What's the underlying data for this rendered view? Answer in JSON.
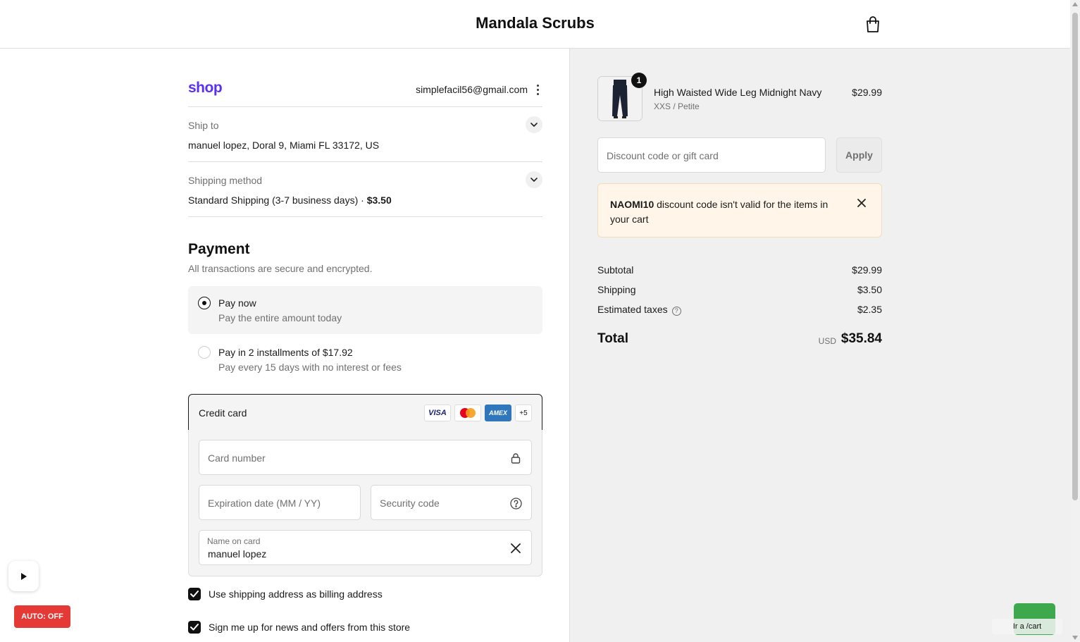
{
  "header": {
    "store_name": "Mandala Scrubs"
  },
  "account": {
    "logo": "shop",
    "email": "simplefacil56@gmail.com"
  },
  "ship_to": {
    "label": "Ship to",
    "value": "manuel lopez, Doral 9, Miami FL 33172, US"
  },
  "shipping_method": {
    "label": "Shipping method",
    "value": "Standard Shipping (3-7 business days)",
    "separator": "·",
    "price": "$3.50"
  },
  "payment": {
    "title": "Payment",
    "subtitle": "All transactions are secure and encrypted.",
    "options": [
      {
        "title": "Pay now",
        "subtitle": "Pay the entire amount today",
        "selected": true
      },
      {
        "title": "Pay in 2 installments of $17.92",
        "subtitle": "Pay every 15 days with no interest or fees",
        "selected": false
      }
    ],
    "credit_card": {
      "label": "Credit card",
      "badges": [
        "VISA",
        "AMEX",
        "+5"
      ],
      "card_number_placeholder": "Card number",
      "expiration_placeholder": "Expiration date (MM / YY)",
      "security_placeholder": "Security code",
      "name_label": "Name on card",
      "name_value": "manuel lopez"
    },
    "checkboxes": [
      {
        "label": "Use shipping address as billing address",
        "checked": true
      },
      {
        "label": "Sign me up for news and offers from this store",
        "checked": true
      }
    ]
  },
  "order": {
    "item": {
      "quantity": "1",
      "name": "High Waisted Wide Leg Midnight Navy",
      "variant": "XXS / Petite",
      "price": "$29.99"
    },
    "discount_placeholder": "Discount code or gift card",
    "apply_label": "Apply",
    "notice": {
      "code": "NAOMI10",
      "message": " discount code isn't valid for the items in your cart"
    },
    "summary": {
      "subtotal_label": "Subtotal",
      "subtotal": "$29.99",
      "shipping_label": "Shipping",
      "shipping": "$3.50",
      "taxes_label": "Estimated taxes",
      "taxes": "$2.35",
      "total_label": "Total",
      "currency": "USD",
      "total": "$35.84"
    }
  },
  "overlays": {
    "auto_label": "AUTO: OFF",
    "go_cart_label": "Ir a /cart"
  },
  "colors": {
    "shop_brand": "#5a31f4",
    "auto_button": "#e53935",
    "green_button": "#3ea84c",
    "notice_bg": "#fff6e9",
    "summary_bg": "#f0f0f0"
  }
}
